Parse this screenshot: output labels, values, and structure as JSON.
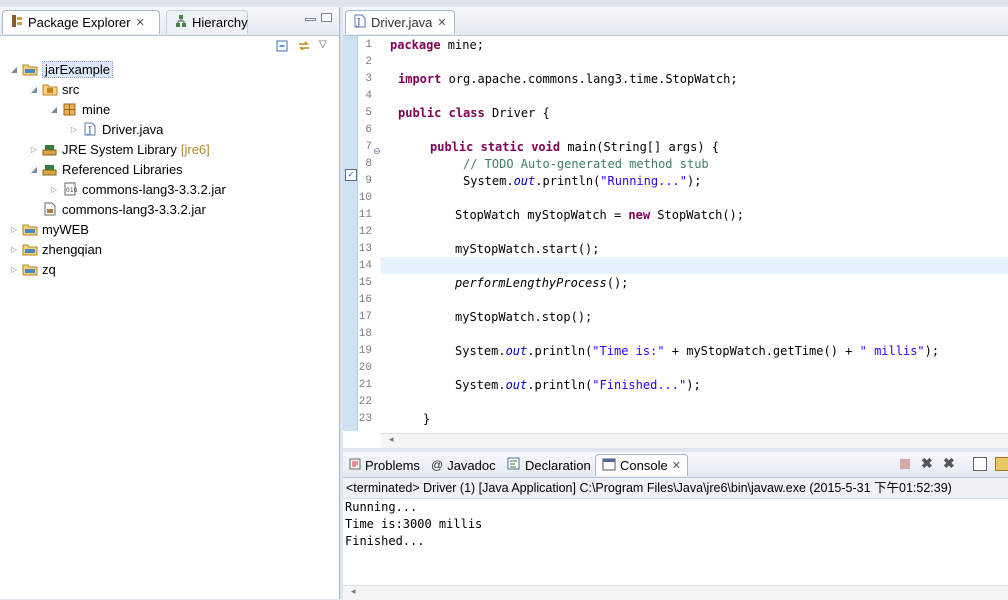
{
  "package_explorer": {
    "tab_label": "Package Explorer",
    "hierarchy_tab_label": "Hierarchy",
    "tree": [
      {
        "label": "jarExample",
        "icon": "project-folder-icon",
        "selected": true
      },
      {
        "label": "src",
        "icon": "source-folder-icon"
      },
      {
        "label": "mine",
        "icon": "package-icon"
      },
      {
        "label": "Driver.java",
        "icon": "java-file-icon"
      },
      {
        "label": "JRE System Library",
        "decoration": "[jre6]",
        "icon": "library-icon"
      },
      {
        "label": "Referenced Libraries",
        "icon": "library-icon"
      },
      {
        "label": "commons-lang3-3.3.2.jar",
        "icon": "jar-icon"
      },
      {
        "label": "commons-lang3-3.3.2.jar",
        "icon": "jar-file-icon"
      },
      {
        "label": "myWEB",
        "icon": "project-folder-icon"
      },
      {
        "label": "zhengqian",
        "icon": "project-folder-icon"
      },
      {
        "label": "zq",
        "icon": "project-folder-icon"
      }
    ]
  },
  "editor": {
    "tab_label": "Driver.java",
    "line_numbers": [
      "1",
      "2",
      "3",
      "4",
      "5",
      "6",
      "7",
      "8",
      "9",
      "10",
      "11",
      "12",
      "13",
      "14",
      "15",
      "16",
      "17",
      "18",
      "19",
      "20",
      "21",
      "22",
      "23"
    ],
    "code": {
      "l1_kw": "package",
      "l1_rest": " mine;",
      "l3_kw": "import",
      "l3_rest": " org.apache.commons.lang3.time.StopWatch;",
      "l5_kw1": "public",
      "l5_kw2": "class",
      "l5_rest": " Driver {",
      "l7_kw1": "public",
      "l7_kw2": "static",
      "l7_kw3": "void",
      "l7_rest": " main(String[] args) {",
      "l8_comment": "// TODO Auto-generated method stub",
      "l9_a": "System.",
      "l9_field": "out",
      "l9_b": ".println(",
      "l9_str": "\"Running...\"",
      "l9_c": ");",
      "l11_a": "StopWatch myStopWatch = ",
      "l11_kw": "new",
      "l11_b": " StopWatch();",
      "l13": "myStopWatch.start();",
      "l15_it": "performLengthyProcess",
      "l15_b": "();",
      "l17": "myStopWatch.stop();",
      "l19_a": "System.",
      "l19_field": "out",
      "l19_b": ".println(",
      "l19_str1": "\"Time is:\"",
      "l19_c": " + myStopWatch.getTime() + ",
      "l19_str2": "\" millis\"",
      "l19_d": ");",
      "l21_a": "System.",
      "l21_field": "out",
      "l21_b": ".println(",
      "l21_str": "\"Finished...\"",
      "l21_c": ");",
      "l23": "}"
    }
  },
  "bottom_panel": {
    "tabs": [
      {
        "label": "Problems",
        "icon": "problems-icon"
      },
      {
        "label": "Javadoc",
        "icon": "javadoc-icon"
      },
      {
        "label": "Declaration",
        "icon": "declaration-icon"
      },
      {
        "label": "Console",
        "icon": "console-icon",
        "active": true
      }
    ],
    "terminated_text": "<terminated> Driver (1) [Java Application] C:\\Program Files\\Java\\jre6\\bin\\javaw.exe (2015-5-31 下午01:52:39)",
    "console_output": [
      "Running...",
      "Time is:3000 millis",
      "Finished..."
    ]
  },
  "colors": {
    "keyword": "#7f0055",
    "comment": "#3f7f5f",
    "string": "#2a00ff",
    "field": "#0000c0",
    "current_line": "#e8f2fe"
  }
}
